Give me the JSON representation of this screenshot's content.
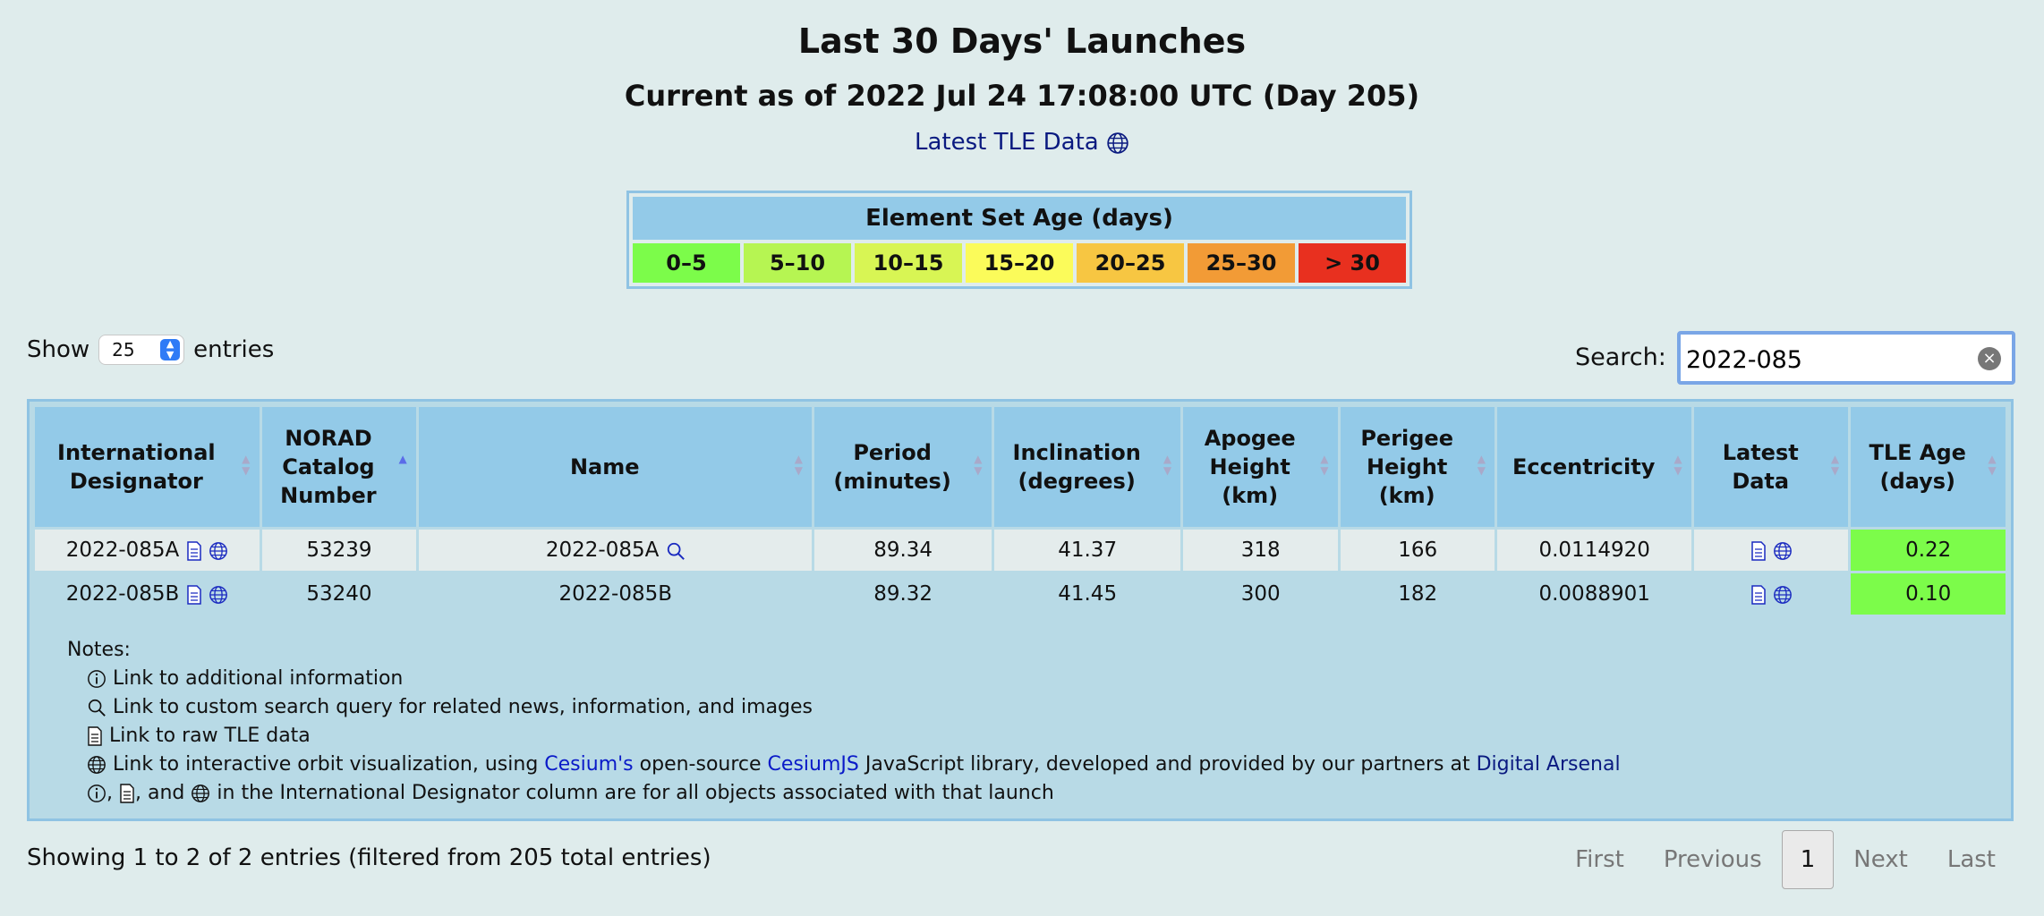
{
  "header": {
    "title": "Last 30 Days' Launches",
    "subtitle": "Current as of 2022 Jul 24 17:08:00 UTC (Day 205)",
    "tle_link": "Latest TLE Data"
  },
  "legend": {
    "title": "Element Set Age (days)",
    "cells": [
      {
        "label": "0–5",
        "color": "#7cfc4a"
      },
      {
        "label": "5–10",
        "color": "#b6f552"
      },
      {
        "label": "10–15",
        "color": "#d8f554"
      },
      {
        "label": "15–20",
        "color": "#fbfb5a"
      },
      {
        "label": "20–25",
        "color": "#f7c642"
      },
      {
        "label": "25–30",
        "color": "#f29b36"
      },
      {
        "label": "> 30",
        "color": "#e8301f"
      }
    ]
  },
  "controls": {
    "show_label": "Show",
    "show_value": "25",
    "entries_label": "entries",
    "search_label": "Search:",
    "search_value": "2022-085"
  },
  "table": {
    "columns": [
      "International Designator",
      "NORAD Catalog Number",
      "Name",
      "Period (minutes)",
      "Inclination (degrees)",
      "Apogee Height (km)",
      "Perigee Height (km)",
      "Eccentricity",
      "Latest Data",
      "TLE Age (days)"
    ],
    "rows": [
      {
        "intl": "2022-085A",
        "norad": "53239",
        "name": "2022-085A",
        "period": "89.34",
        "incl": "41.37",
        "apogee": "318",
        "perigee": "166",
        "ecc": "0.0114920",
        "age": "0.22"
      },
      {
        "intl": "2022-085B",
        "norad": "53240",
        "name": "2022-085B",
        "period": "89.32",
        "incl": "41.45",
        "apogee": "300",
        "perigee": "182",
        "ecc": "0.0088901",
        "age": "0.10"
      }
    ]
  },
  "notes": {
    "title": "Notes:",
    "line1": "Link to additional information",
    "line2": "Link to custom search query for related news, information, and images",
    "line3": "Link to raw TLE data",
    "line4_a": "Link to interactive orbit visualization, using",
    "line4_cesium": "Cesium's",
    "line4_b": "open-source",
    "line4_cesiumjs": "CesiumJS",
    "line4_c": "JavaScript library, developed and provided by our partners at",
    "line4_da": "Digital Arsenal",
    "line5_a": ",",
    "line5_b": ", and",
    "line5_c": "in the International Designator column are for all objects associated with that launch"
  },
  "footer": {
    "status": "Showing 1 to 2 of 2 entries (filtered from 205 total entries)",
    "first": "First",
    "previous": "Previous",
    "current": "1",
    "next": "Next",
    "last": "Last"
  }
}
